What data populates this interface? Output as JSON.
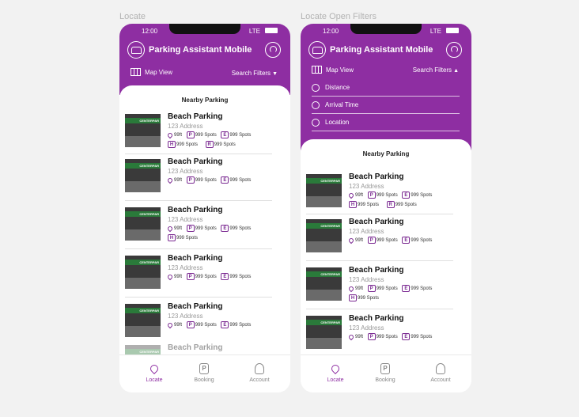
{
  "frames": [
    {
      "label": "Locate"
    },
    {
      "label": "Locate Open Filters"
    }
  ],
  "status": {
    "time": "12:00",
    "network": "LTE"
  },
  "header": {
    "title": "Parking Assistant Mobile",
    "map_view": "Map View",
    "search_filters": "Search Filters",
    "caret_closed": "▼",
    "caret_open": "▲"
  },
  "filters": [
    {
      "label": "Distance",
      "icon": "location-pin-icon"
    },
    {
      "label": "Arrival Time",
      "icon": "clock-icon"
    },
    {
      "label": "Location",
      "icon": "map-pin-icon"
    }
  ],
  "list_title": "Nearby Parking",
  "spot_letters": {
    "p": "P",
    "e": "E",
    "h": "H",
    "r": "R"
  },
  "locate_cards": [
    {
      "name": "Beach Parking",
      "address": "123 Address",
      "distance": "99ft",
      "p": "999 Spots",
      "e": "999 Spots",
      "h": "999 Spots",
      "r": "999 Spots"
    },
    {
      "name": "Beach Parking",
      "address": "123 Address",
      "distance": "99ft",
      "p": "999 Spots",
      "e": "999 Spots"
    },
    {
      "name": "Beach Parking",
      "address": "123 Address",
      "distance": "99ft",
      "p": "999 Spots",
      "e": "999 Spots",
      "h": "999 Spots"
    },
    {
      "name": "Beach Parking",
      "address": "123 Address",
      "distance": "99ft",
      "p": "999 Spots",
      "e": "999 Spots"
    },
    {
      "name": "Beach Parking",
      "address": "123 Address",
      "distance": "99ft",
      "p": "999 Spots",
      "e": "999 Spots"
    },
    {
      "name": "Beach Parking"
    }
  ],
  "filter_cards": [
    {
      "name": "Beach Parking",
      "address": "123 Address",
      "distance": "99ft",
      "p": "999 Spots",
      "e": "999 Spots",
      "h": "999 Spots",
      "r": "999 Spots"
    },
    {
      "name": "Beach Parking",
      "address": "123 Address",
      "distance": "99ft",
      "p": "999 Spots",
      "e": "999 Spots"
    },
    {
      "name": "Beach Parking",
      "address": "123 Address",
      "distance": "99ft",
      "p": "999 Spots",
      "e": "999 Spots",
      "h": "999 Spots"
    },
    {
      "name": "Beach Parking",
      "address": "123 Address",
      "distance": "99ft",
      "p": "999 Spots",
      "e": "999 Spots"
    }
  ],
  "thumb_sign": "CENTERPAR",
  "tabs": [
    {
      "label": "Locate",
      "icon": "location-pin-icon",
      "active": true
    },
    {
      "label": "Booking",
      "icon": "parking-icon"
    },
    {
      "label": "Account",
      "icon": "person-icon"
    }
  ],
  "colors": {
    "brand": "#8e2ea2",
    "background": "#f2f2f2"
  }
}
